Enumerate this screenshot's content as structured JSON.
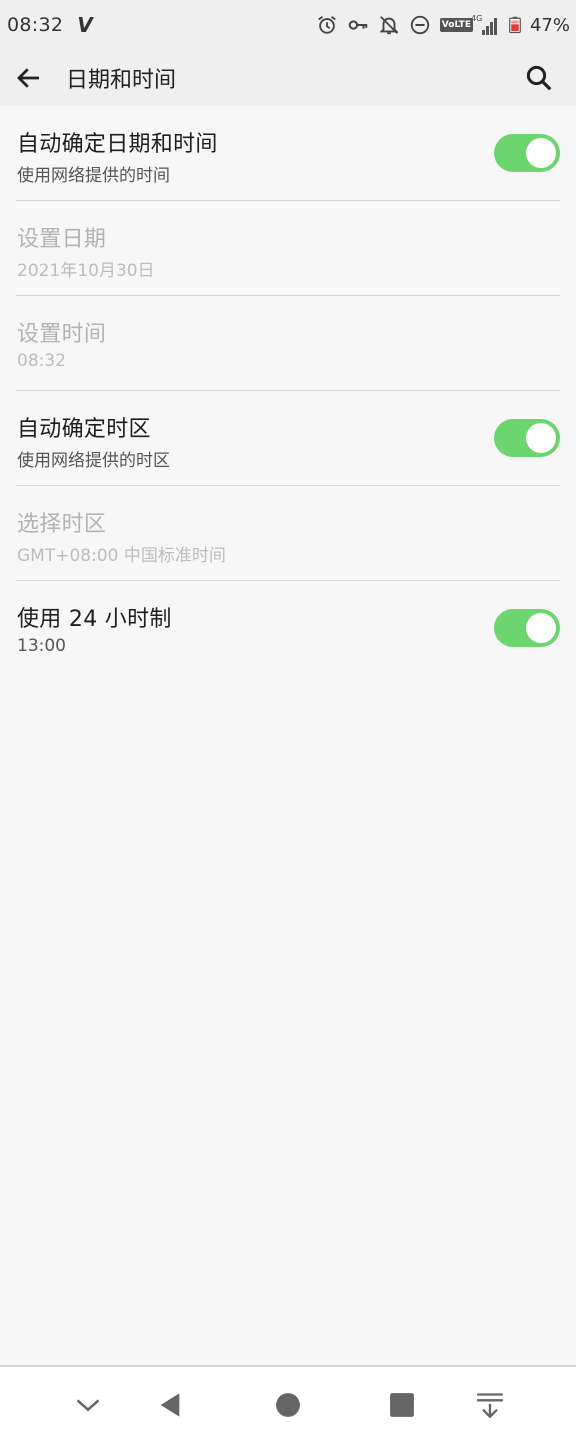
{
  "status_bar": {
    "time": "08:32",
    "carrier_glyph": "V",
    "icons": [
      "alarm-icon",
      "vpn-key-icon",
      "notifications-off-icon",
      "do-not-disturb-icon",
      "volte-icon",
      "signal-4g-icon",
      "battery-icon"
    ],
    "volte_label": "VoLTE",
    "network_label": "4G",
    "battery_percent": "47%",
    "battery_color": "#e53935"
  },
  "app_bar": {
    "title": "日期和时间",
    "back_icon": "arrow-back-icon",
    "search_icon": "search-icon"
  },
  "settings": [
    {
      "title": "自动确定日期和时间",
      "summary": "使用网络提供的时间",
      "enabled": true,
      "switch_on": true
    },
    {
      "title": "设置日期",
      "summary": "2021年10月30日",
      "enabled": false
    },
    {
      "title": "设置时间",
      "summary": "08:32",
      "enabled": false
    },
    {
      "title": "自动确定时区",
      "summary": "使用网络提供的时区",
      "enabled": true,
      "switch_on": true
    },
    {
      "title": "选择时区",
      "summary": "GMT+08:00 中国标准时间",
      "enabled": false
    },
    {
      "title": "使用 24 小时制",
      "summary": "13:00",
      "enabled": true,
      "switch_on": true
    }
  ],
  "nav_bar": {
    "buttons": [
      "chevron-down-icon",
      "back-triangle-icon",
      "home-circle-icon",
      "recents-square-icon",
      "pull-down-icon"
    ]
  },
  "colors": {
    "accent_switch": "#6dd56d",
    "background": "#f7f7f7",
    "app_bar": "#efefef"
  }
}
